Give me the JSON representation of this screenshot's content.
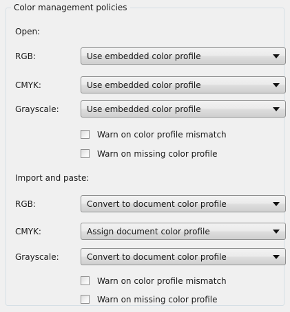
{
  "group_title": "Color management policies",
  "open": {
    "heading": "Open:",
    "rgb": {
      "label": "RGB:",
      "value": "Use embedded color profile"
    },
    "cmyk": {
      "label": "CMYK:",
      "value": "Use embedded color profile"
    },
    "grayscale": {
      "label": "Grayscale:",
      "value": "Use embedded color profile"
    },
    "warn_mismatch": {
      "label": "Warn on color profile mismatch",
      "checked": false
    },
    "warn_missing": {
      "label": "Warn on missing color profile",
      "checked": false
    }
  },
  "import_paste": {
    "heading": "Import and paste:",
    "rgb": {
      "label": "RGB:",
      "value": "Convert to document color profile"
    },
    "cmyk": {
      "label": "CMYK:",
      "value": "Assign document color profile"
    },
    "grayscale": {
      "label": "Grayscale:",
      "value": "Convert to document color profile"
    },
    "warn_mismatch": {
      "label": "Warn on color profile mismatch",
      "checked": false
    },
    "warn_missing": {
      "label": "Warn on missing color profile",
      "checked": false
    }
  }
}
